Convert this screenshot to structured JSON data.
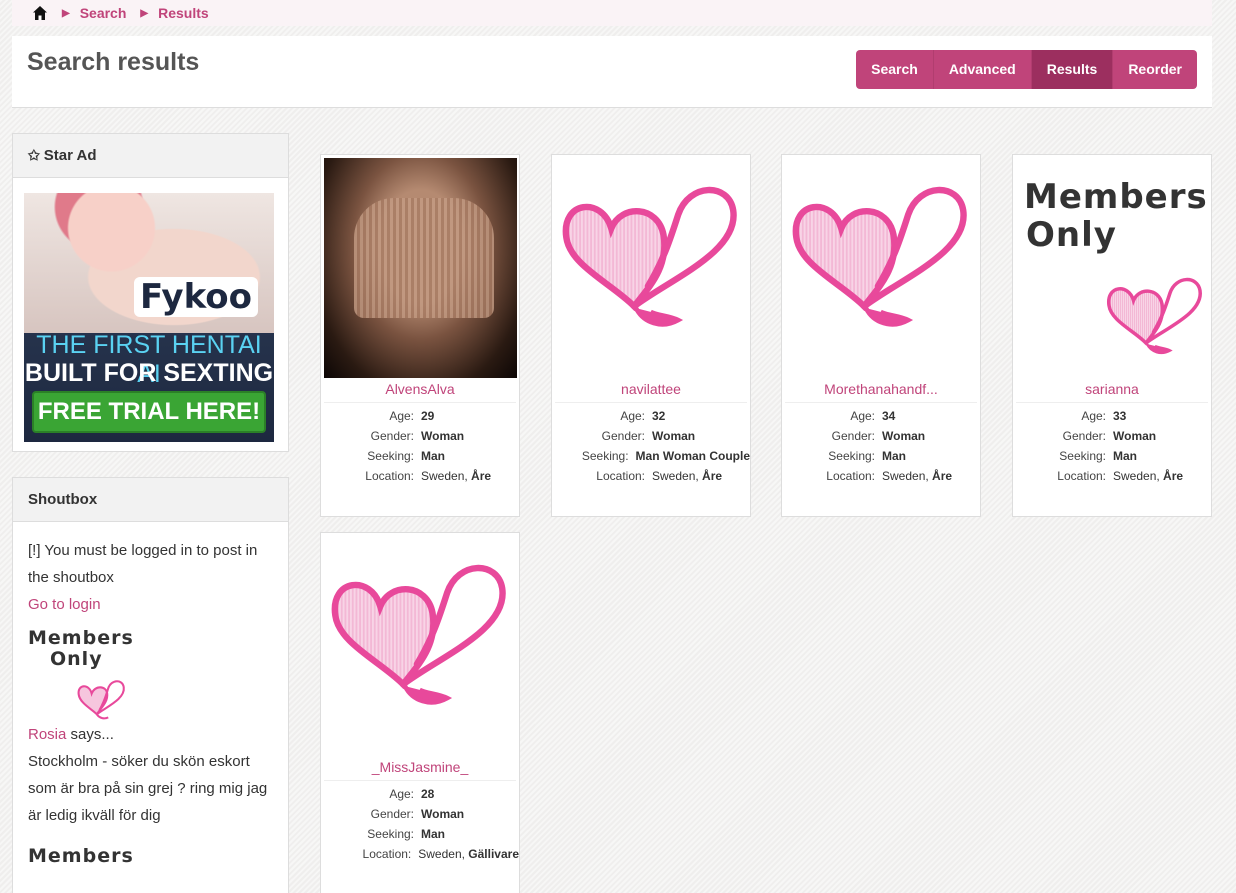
{
  "breadcrumb": {
    "items": [
      "Search",
      "Results"
    ]
  },
  "header": {
    "title": "Search results",
    "buttons": [
      "Search",
      "Advanced",
      "Results",
      "Reorder"
    ],
    "active": "Results"
  },
  "star_ad": {
    "title": "Star Ad",
    "brand": "Fykoo",
    "line1": "THE FIRST HENTAI AI",
    "line2": "BUILT FOR SEXTING",
    "cta": "FREE TRIAL HERE!"
  },
  "shoutbox": {
    "title": "Shoutbox",
    "notice": "[!] You must be logged in to post in the shoutbox",
    "login_link": "Go to login",
    "members_only_1": "Members",
    "members_only_2": "Only",
    "post_user": "Rosia",
    "post_says": "says...",
    "post_text": "Stockholm - söker du skön eskort som är bra på sin grej ? ring mig jag är ledig ikväll för dig",
    "next_members": "Members"
  },
  "labels": {
    "age": "Age:",
    "gender": "Gender:",
    "seeking": "Seeking:",
    "location": "Location:"
  },
  "colors": {
    "accent": "#c0447a",
    "accent_active": "#9c2f5f",
    "heart": "#e8499b"
  },
  "results": [
    {
      "name": "AlvensAlva",
      "age": "29",
      "gender": "Woman",
      "seeking": "Man",
      "country": "Sweden,",
      "city": "Åre",
      "image": "photo"
    },
    {
      "name": "navilattee",
      "age": "32",
      "gender": "Woman",
      "seeking": "Man Woman Couple",
      "country": "Sweden,",
      "city": "Åre",
      "image": "heart-icon"
    },
    {
      "name": "Morethanahandf...",
      "age": "34",
      "gender": "Woman",
      "seeking": "Man",
      "country": "Sweden,",
      "city": "Åre",
      "image": "heart-icon"
    },
    {
      "name": "sarianna",
      "age": "33",
      "gender": "Woman",
      "seeking": "Man",
      "country": "Sweden,",
      "city": "Åre",
      "image": "members-only",
      "mo_1": "Members",
      "mo_2": "Only"
    },
    {
      "name": "_MissJasmine_",
      "age": "28",
      "gender": "Woman",
      "seeking": "Man",
      "country": "Sweden,",
      "city": "Gällivare",
      "image": "heart-icon"
    }
  ]
}
